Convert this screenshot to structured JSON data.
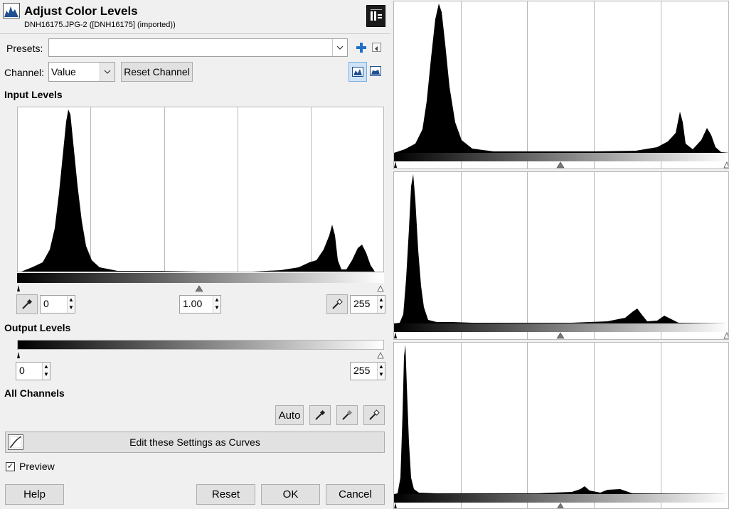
{
  "header": {
    "title": "Adjust Color Levels",
    "subtitle": "DNH16175.JPG-2 ([DNH16175] (imported))"
  },
  "presets": {
    "label": "Presets:",
    "value": ""
  },
  "channel": {
    "label": "Channel:",
    "value": "Value",
    "reset_label": "Reset Channel"
  },
  "input_levels": {
    "heading": "Input Levels",
    "low": "0",
    "gamma": "1.00",
    "high": "255"
  },
  "output_levels": {
    "heading": "Output Levels",
    "low": "0",
    "high": "255"
  },
  "all_channels": {
    "heading": "All Channels",
    "auto_label": "Auto"
  },
  "curves": {
    "label": "Edit these Settings as Curves"
  },
  "preview": {
    "label": "Preview",
    "checked": true
  },
  "footer": {
    "help": "Help",
    "reset": "Reset",
    "ok": "OK",
    "cancel": "Cancel"
  },
  "icons": {
    "app": "levels-icon",
    "dock": "dock-icon",
    "add_preset": "plus-icon",
    "preset_menu": "menu-arrow-icon",
    "linear": "linear-histogram-icon",
    "log": "log-histogram-icon",
    "picker": "eyedropper-icon",
    "curves": "curves-icon"
  },
  "colors": {
    "accent": "#1f6fc5",
    "histogram": "#000000",
    "background": "#f0f0f0"
  }
}
